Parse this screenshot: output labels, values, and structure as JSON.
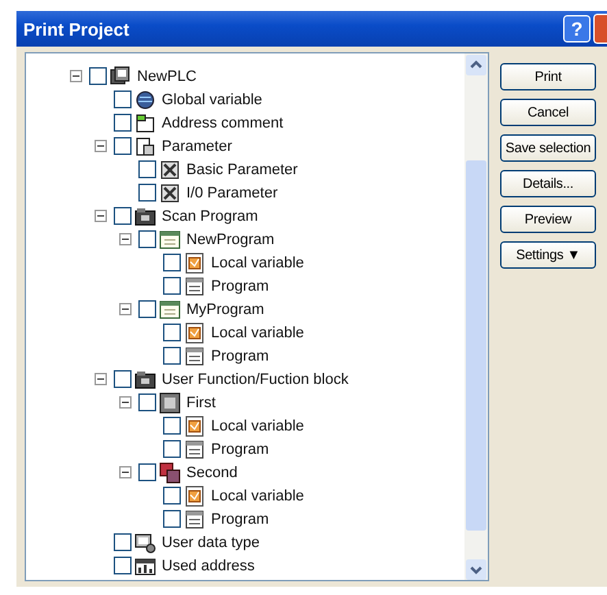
{
  "window": {
    "title": "Print Project",
    "help": "?"
  },
  "tree": [
    {
      "label": "NewPLC",
      "kind": "plc",
      "checked": false,
      "expanded": true,
      "children": [
        {
          "label": "Global variable",
          "kind": "globe",
          "checked": false
        },
        {
          "label": "Address comment",
          "kind": "comment",
          "checked": false
        },
        {
          "label": "Parameter",
          "kind": "parameter",
          "checked": false,
          "expanded": true,
          "children": [
            {
              "label": "Basic Parameter",
              "kind": "param-item",
              "checked": false
            },
            {
              "label": "I/0 Parameter",
              "kind": "param-item",
              "checked": false
            }
          ]
        },
        {
          "label": "Scan Program",
          "kind": "folder",
          "checked": false,
          "expanded": true,
          "children": [
            {
              "label": "NewProgram",
              "kind": "program-block",
              "checked": false,
              "expanded": true,
              "children": [
                {
                  "label": "Local variable",
                  "kind": "variable",
                  "checked": false
                },
                {
                  "label": "Program",
                  "kind": "listing",
                  "checked": false
                }
              ]
            },
            {
              "label": "MyProgram",
              "kind": "program-block",
              "checked": false,
              "expanded": true,
              "children": [
                {
                  "label": "Local variable",
                  "kind": "variable",
                  "checked": false
                },
                {
                  "label": "Program",
                  "kind": "listing",
                  "checked": false
                }
              ]
            }
          ]
        },
        {
          "label": "User Function/Fuction block",
          "kind": "folder",
          "checked": false,
          "expanded": true,
          "children": [
            {
              "label": "First",
              "kind": "function",
              "checked": false,
              "expanded": true,
              "children": [
                {
                  "label": "Local variable",
                  "kind": "variable",
                  "checked": false
                },
                {
                  "label": "Program",
                  "kind": "listing",
                  "checked": false
                }
              ]
            },
            {
              "label": "Second",
              "kind": "function-block",
              "checked": false,
              "expanded": true,
              "children": [
                {
                  "label": "Local variable",
                  "kind": "variable",
                  "checked": false
                },
                {
                  "label": "Program",
                  "kind": "listing",
                  "checked": false
                }
              ]
            }
          ]
        },
        {
          "label": "User data type",
          "kind": "data-type",
          "checked": false
        },
        {
          "label": "Used address",
          "kind": "address",
          "checked": false
        }
      ]
    }
  ],
  "buttons": [
    "Print",
    "Cancel",
    "Save selection",
    "Details...",
    "Preview",
    "Settings ▼"
  ]
}
